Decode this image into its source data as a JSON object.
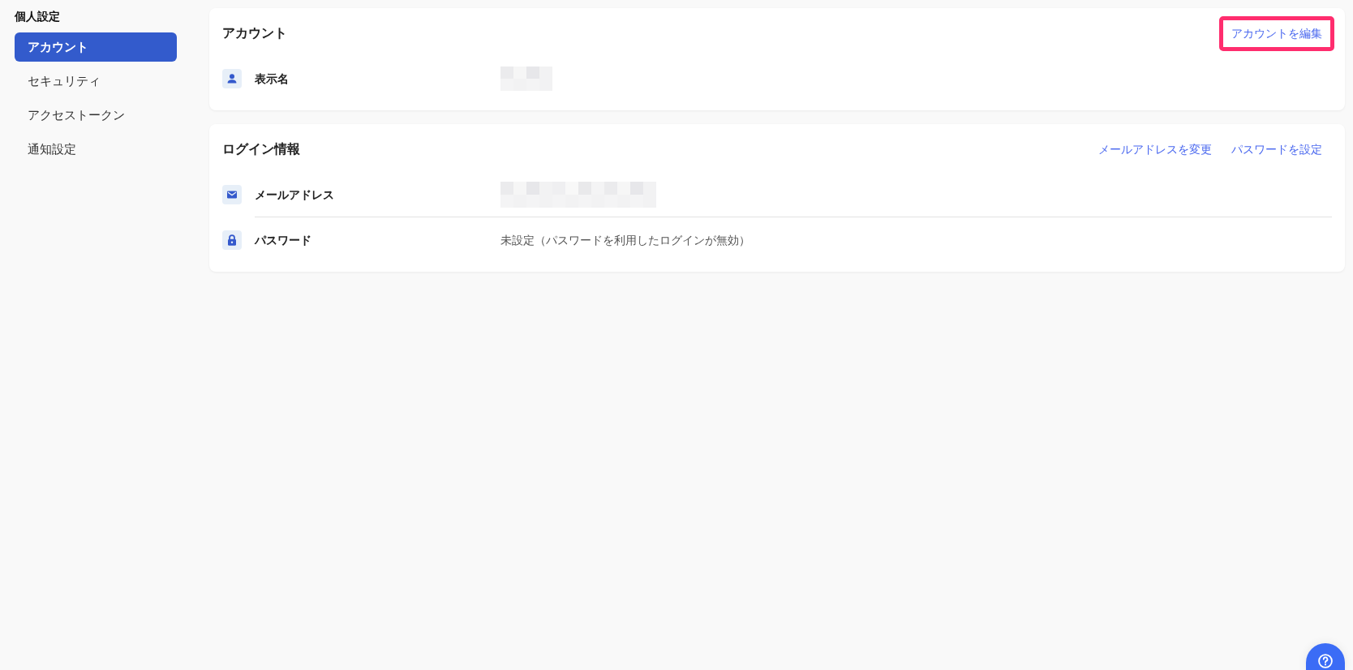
{
  "sidebar": {
    "heading": "個人設定",
    "items": [
      {
        "label": "アカウント",
        "selected": true
      },
      {
        "label": "セキュリティ",
        "selected": false
      },
      {
        "label": "アクセストークン",
        "selected": false
      },
      {
        "label": "通知設定",
        "selected": false
      }
    ]
  },
  "sections": [
    {
      "title": "アカウント",
      "actions": [
        {
          "label": "アカウントを編集",
          "highlighted": true
        }
      ],
      "rows": [
        {
          "kind": "name",
          "label": "表示名",
          "redacted": true
        }
      ]
    },
    {
      "title": "ログイン情報",
      "actions": [
        {
          "label": "メールアドレスを変更",
          "highlighted": false
        },
        {
          "label": "パスワードを設定",
          "highlighted": false
        }
      ],
      "rows": [
        {
          "kind": "email",
          "label": "メールアドレス",
          "redacted": true
        },
        {
          "kind": "password",
          "label": "パスワード",
          "redacted": false,
          "value": "未設定（パスワードを利用したログインが無効）"
        }
      ]
    }
  ]
}
